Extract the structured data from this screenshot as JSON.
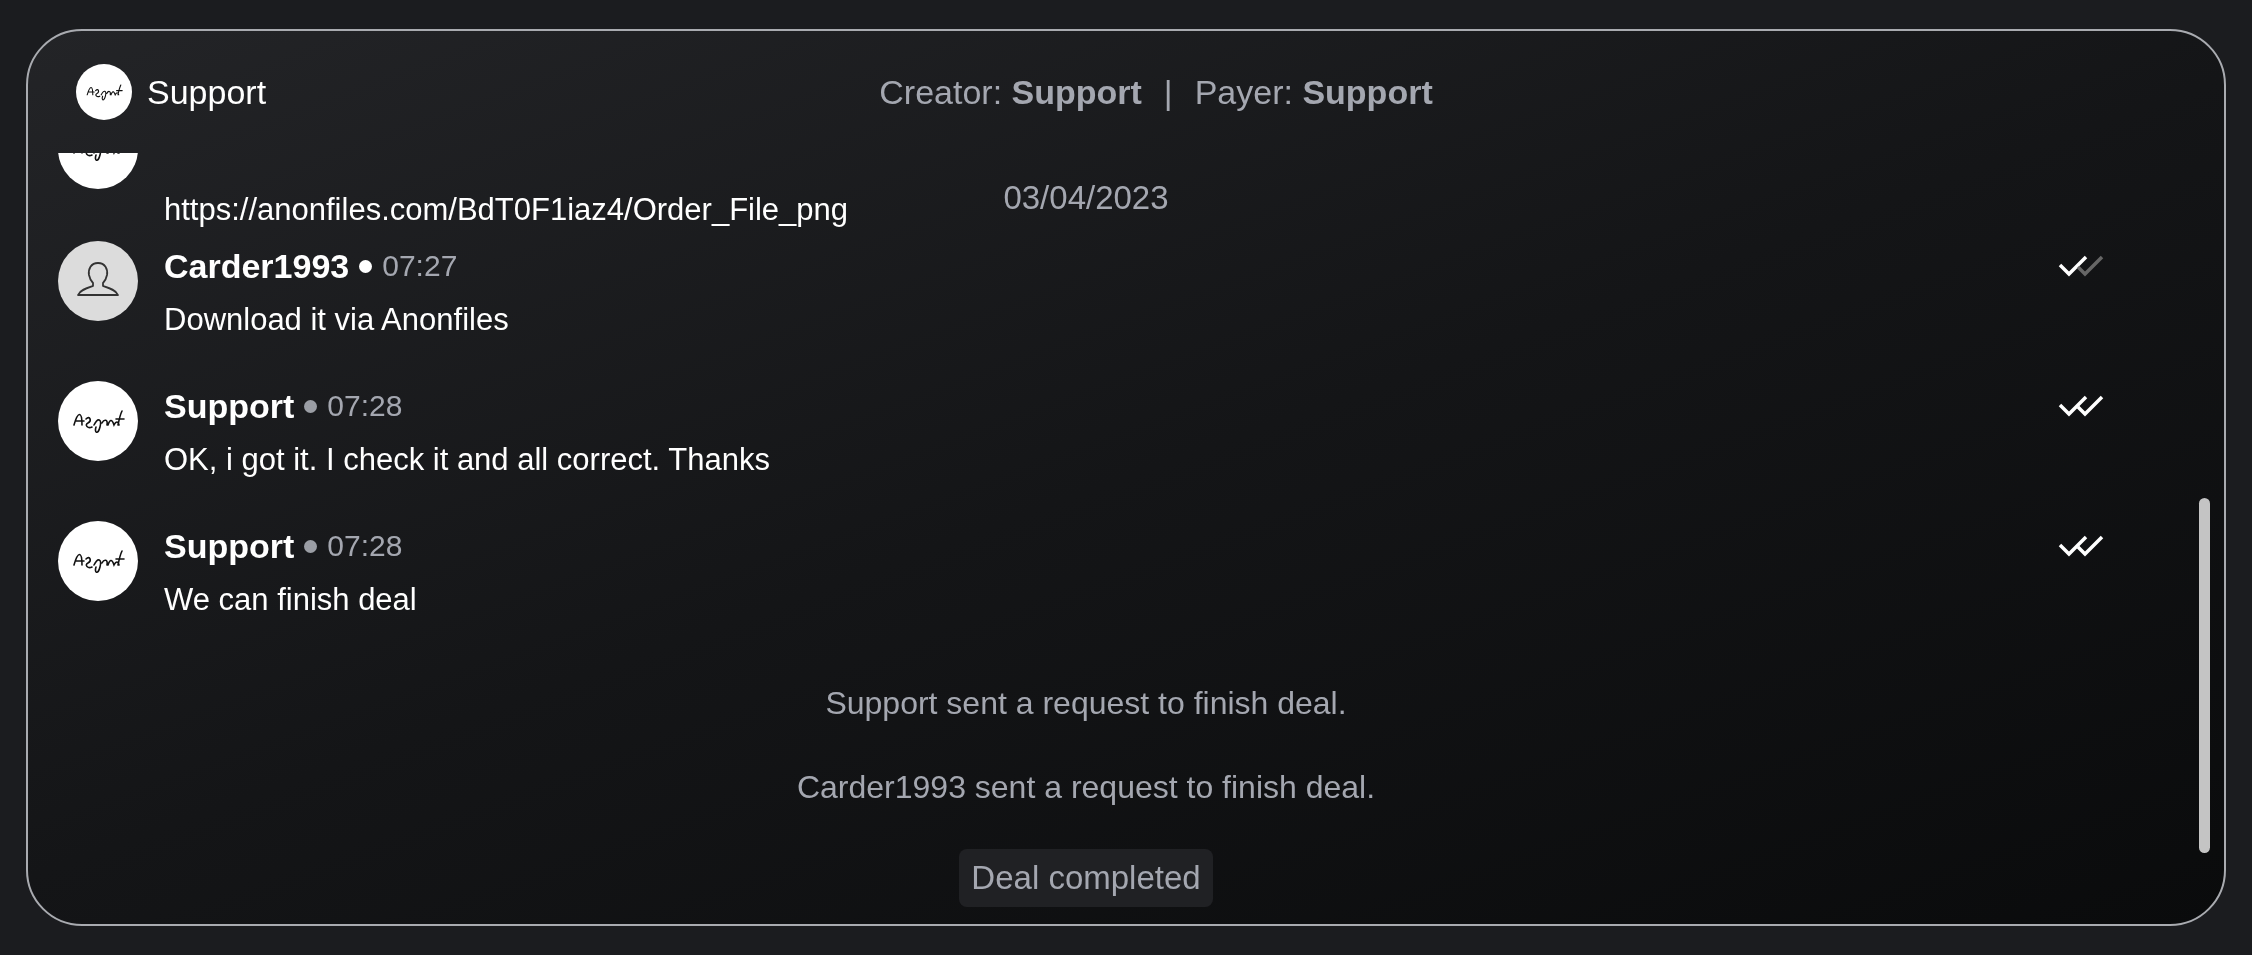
{
  "header": {
    "name": "Support",
    "creator_label": "Creator:",
    "creator": "Support",
    "separator": "|",
    "payer_label": "Payer:",
    "payer": "Support"
  },
  "feed": [
    {
      "kind": "message",
      "avatar": {
        "kind": "signature"
      },
      "partial": true,
      "text": "https://anonfiles.com/BdT0F1iaz4/Order_File_png"
    },
    {
      "kind": "date",
      "text": "03/04/2023"
    },
    {
      "kind": "message",
      "avatar": {
        "kind": "person"
      },
      "name": "Carder1993",
      "online": true,
      "time": "07:27",
      "text": "Download it via Anonfiles",
      "read": false
    },
    {
      "kind": "message",
      "avatar": {
        "kind": "signature"
      },
      "name": "Support",
      "online": false,
      "time": "07:28",
      "text": "OK, i got it. I check it and all correct. Thanks",
      "read": true
    },
    {
      "kind": "message",
      "avatar": {
        "kind": "signature"
      },
      "name": "Support",
      "online": false,
      "time": "07:28",
      "text": "We can finish deal",
      "read": true
    },
    {
      "kind": "system",
      "text": "Support sent a request to finish deal."
    },
    {
      "kind": "system",
      "text": "Carder1993 sent a request to finish deal."
    },
    {
      "kind": "status",
      "text": "Deal completed"
    }
  ]
}
